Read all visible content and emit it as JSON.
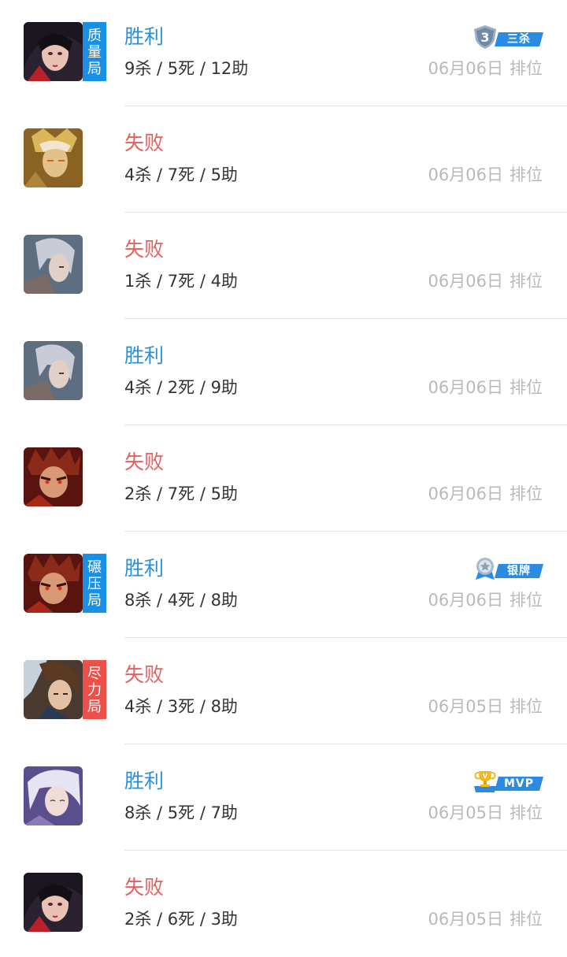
{
  "matches": [
    {
      "result": "胜利",
      "kda": "9杀 / 5死 / 12助",
      "date": "06月06日",
      "mode": "排位",
      "tag": [
        "质",
        "量",
        "局"
      ],
      "badge": "三杀"
    },
    {
      "result": "失败",
      "kda": "4杀 / 7死 / 5助",
      "date": "06月06日",
      "mode": "排位"
    },
    {
      "result": "失败",
      "kda": "1杀 / 7死 / 4助",
      "date": "06月06日",
      "mode": "排位"
    },
    {
      "result": "胜利",
      "kda": "4杀 / 2死 / 9助",
      "date": "06月06日",
      "mode": "排位"
    },
    {
      "result": "失败",
      "kda": "2杀 / 7死 / 5助",
      "date": "06月06日",
      "mode": "排位"
    },
    {
      "result": "胜利",
      "kda": "8杀 / 4死 / 8助",
      "date": "06月06日",
      "mode": "排位",
      "tag": [
        "碾",
        "压",
        "局"
      ],
      "badge": "银牌"
    },
    {
      "result": "失败",
      "kda": "4杀 / 3死 / 8助",
      "date": "06月05日",
      "mode": "排位",
      "tag": [
        "尽",
        "力",
        "局"
      ]
    },
    {
      "result": "胜利",
      "kda": "8杀 / 5死 / 7助",
      "date": "06月05日",
      "mode": "排位",
      "badge": "MVP"
    },
    {
      "result": "失败",
      "kda": "2杀 / 6死 / 3助",
      "date": "06月05日",
      "mode": "排位"
    }
  ],
  "colors": {
    "win": "#2a8ed8",
    "lose": "#e8605e",
    "tag_blue": "#1a8fe6",
    "tag_red": "#ee4f4a",
    "meta_gray": "#b9b9b9",
    "text_dark": "#333333"
  },
  "icons": {
    "row0": "hero-portrait-dark-hair",
    "row1": "hero-portrait-golden-armor",
    "row2": "hero-portrait-silver-hair",
    "row3": "hero-portrait-silver-hair",
    "row4": "hero-portrait-red-spiky-hair",
    "row5": "hero-portrait-red-spiky-hair",
    "row6": "hero-portrait-brown-hair",
    "row7": "hero-portrait-white-hair",
    "row8": "hero-portrait-dark-hair",
    "badge_triple_kill": "shield-3-icon",
    "badge_silver": "silver-medal-icon",
    "badge_mvp": "trophy-icon"
  }
}
